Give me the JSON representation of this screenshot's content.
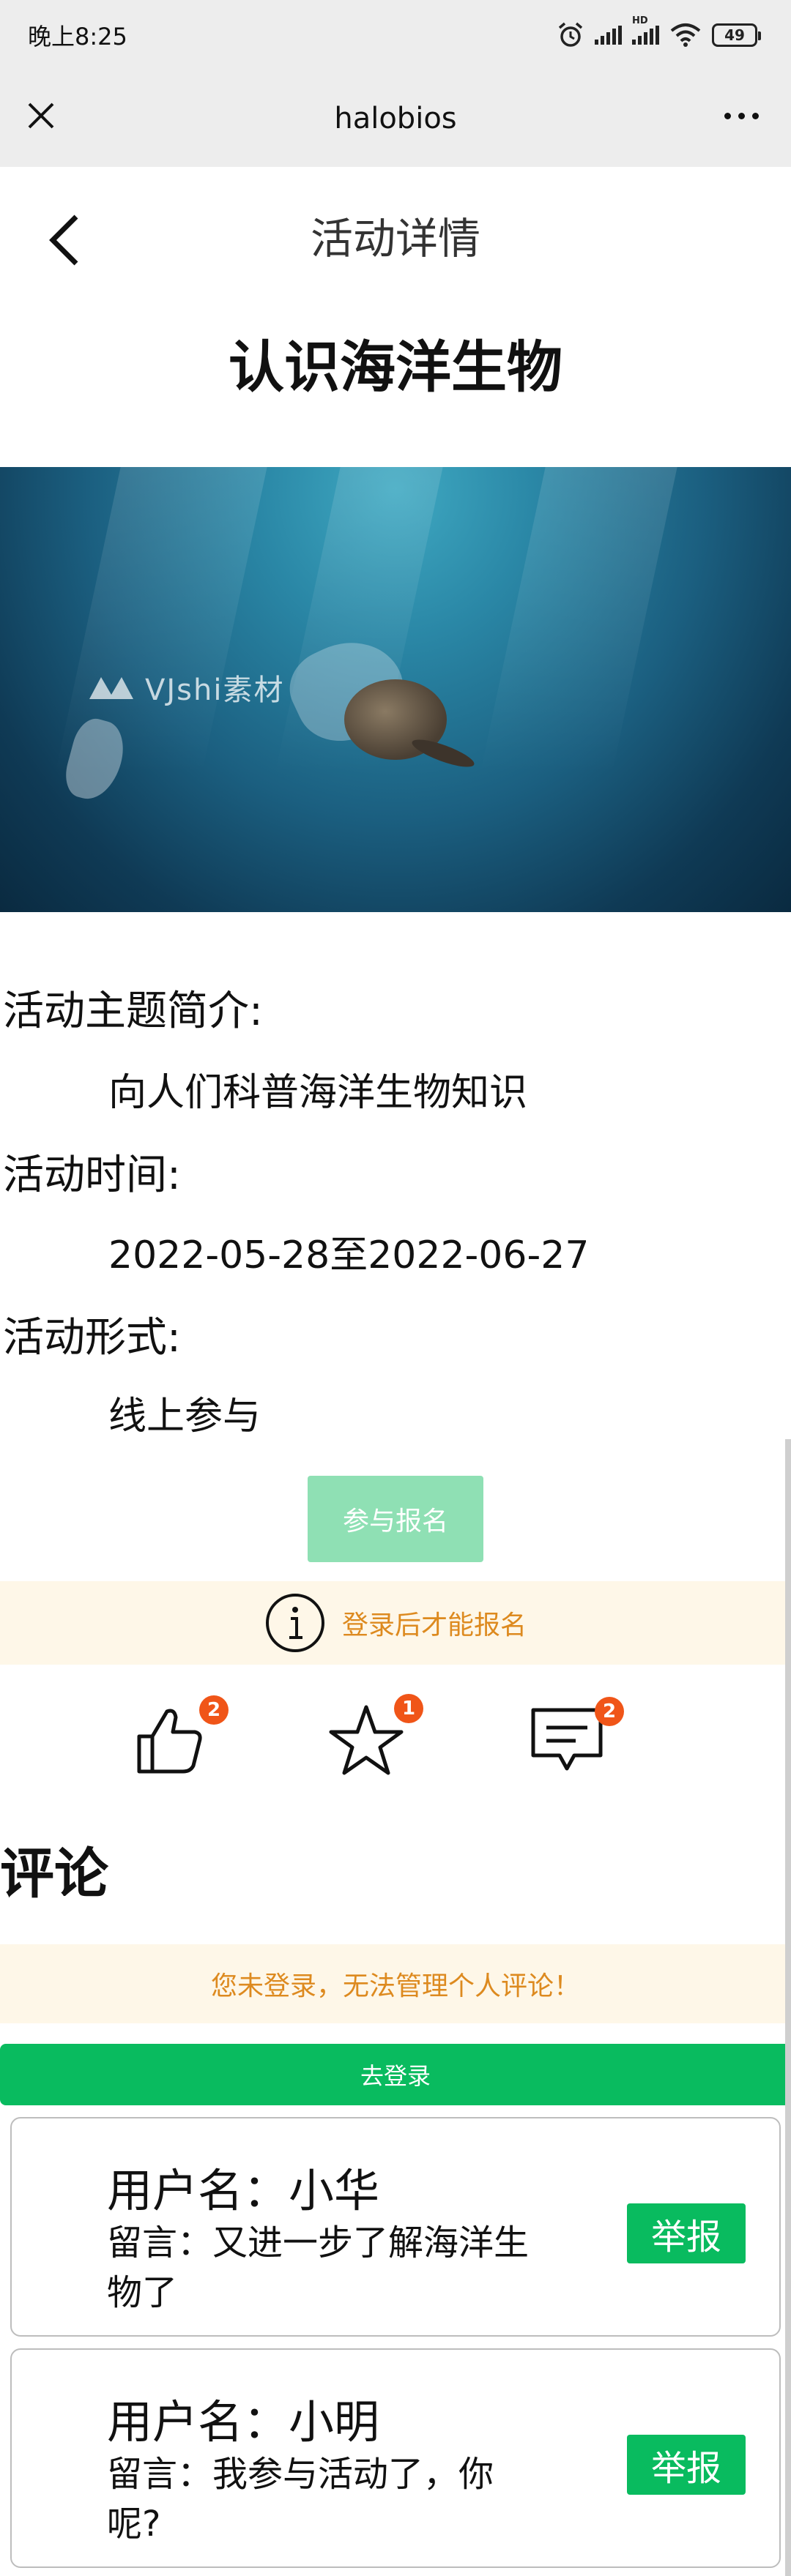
{
  "status_bar": {
    "time": "晚上8:25",
    "hd_label": "HD",
    "battery": "49"
  },
  "wechat_nav": {
    "title": "halobios"
  },
  "header": {
    "title": "活动详情"
  },
  "activity": {
    "title": "认识海洋生物",
    "banner_watermark": "VJshi素材",
    "topic_label": "活动主题简介:",
    "topic_value": "向人们科普海洋生物知识",
    "time_label": "活动时间:",
    "time_value": "2022-05-28至2022-06-27",
    "format_label": "活动形式:",
    "format_value": "线上参与",
    "signup_label": "参与报名"
  },
  "login_notice": {
    "icon": "info-icon",
    "text": "登录后才能报名"
  },
  "actions": {
    "like": {
      "icon": "thumbs-up-icon",
      "count": "2"
    },
    "favorite": {
      "icon": "star-icon",
      "count": "1"
    },
    "comment": {
      "icon": "comment-icon",
      "count": "2"
    }
  },
  "comments": {
    "heading": "评论",
    "not_logged_text": "您未登录，无法管理个人评论！",
    "login_button": "去登录",
    "items": [
      {
        "user": "用户名：小华",
        "message": "留言：又进一步了解海洋生物了",
        "report_label": "举报"
      },
      {
        "user": "用户名：小明",
        "message": "留言：我参与活动了，你呢?",
        "report_label": "举报"
      }
    ]
  },
  "colors": {
    "green": "#09bb5f",
    "light_green": "#8fe0b4",
    "warning_bg": "#fef7e8",
    "warning_text": "#dd8a1f",
    "badge": "#f05518"
  }
}
